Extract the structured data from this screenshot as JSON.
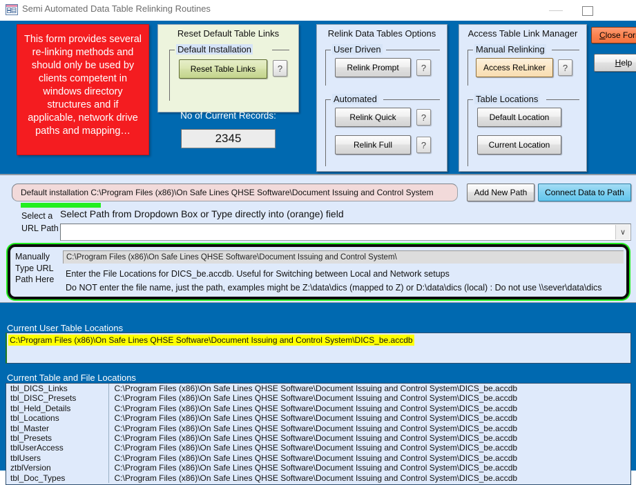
{
  "window": {
    "title": "Semi Automated Data Table Relinking Routines",
    "app_icon": "table-window-icon",
    "minimize_label": "",
    "maximize_label": ""
  },
  "warning": {
    "text": "This form provides several re-linking methods and should only be used by clients competent in windows directory structures and if applicable, network drive paths and mapping…"
  },
  "reset_panel": {
    "title": "Reset Default Table Links",
    "group_label": "Default Installation",
    "button_label": "Reset Table Links",
    "help_label": "?"
  },
  "records": {
    "label": "No of Current Records:",
    "value": "2345"
  },
  "relink_panel": {
    "title": "Relink Data Tables Options",
    "groups": [
      {
        "label": "User Driven",
        "buttons": [
          {
            "label": "Relink Prompt",
            "help": "?"
          }
        ]
      },
      {
        "label": "Automated",
        "buttons": [
          {
            "label": "Relink Quick",
            "help": "?"
          },
          {
            "label": "Relink Full",
            "help": "?"
          }
        ]
      }
    ]
  },
  "access_panel": {
    "title": "Access Table Link Manager",
    "groups": [
      {
        "label": "Manual Relinking",
        "buttons": [
          {
            "label": "Access ReLinker",
            "help": "?"
          }
        ]
      },
      {
        "label": "Table Locations",
        "buttons": [
          {
            "label": "Default Location",
            "help": ""
          },
          {
            "label": "Current Location",
            "help": ""
          }
        ]
      }
    ]
  },
  "side_buttons": {
    "close_form": "Close Form",
    "close_form_key": "C",
    "close_form_rest": "lose Form",
    "help": "Help",
    "help_key": "H",
    "help_rest": "elp"
  },
  "path_section": {
    "default_path": "Default installation C:\\Program Files (x86)\\On Safe Lines QHSE Software\\Document Issuing and Control System",
    "add_new_path_label": "Add New Path",
    "connect_label": "Connect Data to Path",
    "select_label_line1": "Select a",
    "select_label_line2": "URL Path",
    "select_hint": "Select Path from Dropdown Box or Type directly into (orange) field",
    "combo_value": "",
    "combo_arrow": "∨"
  },
  "manual_entry": {
    "label": "Manually Type URL Path Here",
    "label_line1": "Manually",
    "label_line2": "Type URL",
    "label_line3": "Path Here",
    "value": "C:\\Program Files (x86)\\On Safe Lines QHSE Software\\Document Issuing and Control System\\",
    "help_line1": "Enter the File Locations for DICS_be.accdb.  Useful for Switching between Local and Network setups",
    "help_line2": "Do NOT enter the file name, just the path, examples might be  Z:\\data\\dics (mapped to Z) or D:\\data\\dics (local) : Do not use \\\\sever\\data\\dics"
  },
  "current_user_table_locations": {
    "header": "Current User Table Locations",
    "value": "C:\\Program Files (x86)\\On Safe Lines QHSE Software\\Document Issuing and Control System\\DICS_be.accdb"
  },
  "current_table_and_file_locations": {
    "header": "Current Table and File Locations",
    "rows": [
      {
        "name": "tbl_DICS_Links",
        "path": "C:\\Program Files (x86)\\On Safe Lines QHSE Software\\Document Issuing and Control System\\DICS_be.accdb"
      },
      {
        "name": "tbl_DISC_Presets",
        "path": "C:\\Program Files (x86)\\On Safe Lines QHSE Software\\Document Issuing and Control System\\DICS_be.accdb"
      },
      {
        "name": "tbl_Held_Details",
        "path": "C:\\Program Files (x86)\\On Safe Lines QHSE Software\\Document Issuing and Control System\\DICS_be.accdb"
      },
      {
        "name": "tbl_Locations",
        "path": "C:\\Program Files (x86)\\On Safe Lines QHSE Software\\Document Issuing and Control System\\DICS_be.accdb"
      },
      {
        "name": "tbl_Master",
        "path": "C:\\Program Files (x86)\\On Safe Lines QHSE Software\\Document Issuing and Control System\\DICS_be.accdb"
      },
      {
        "name": "tbl_Presets",
        "path": "C:\\Program Files (x86)\\On Safe Lines QHSE Software\\Document Issuing and Control System\\DICS_be.accdb"
      },
      {
        "name": "tblUserAccess",
        "path": "C:\\Program Files (x86)\\On Safe Lines QHSE Software\\Document Issuing and Control System\\DICS_be.accdb"
      },
      {
        "name": "tblUsers",
        "path": "C:\\Program Files (x86)\\On Safe Lines QHSE Software\\Document Issuing and Control System\\DICS_be.accdb"
      },
      {
        "name": "ztblVersion",
        "path": "C:\\Program Files (x86)\\On Safe Lines QHSE Software\\Document Issuing and Control System\\DICS_be.accdb"
      },
      {
        "name": "tbl_Doc_Types",
        "path": "C:\\Program Files (x86)\\On Safe Lines QHSE Software\\Document Issuing and Control System\\DICS_be.accdb"
      }
    ]
  },
  "colors": {
    "form_background": "#0069b0",
    "panel_background": "#dfeafb",
    "warning_red": "#f41c20",
    "reset_panel_green": "#edf4dd",
    "highlight_green": "#22ef1f",
    "highlight_yellow": "#ffff00",
    "orange_field": "#f2dada",
    "close_button": "#fb8350",
    "connect_button": "#7fd0f0"
  }
}
